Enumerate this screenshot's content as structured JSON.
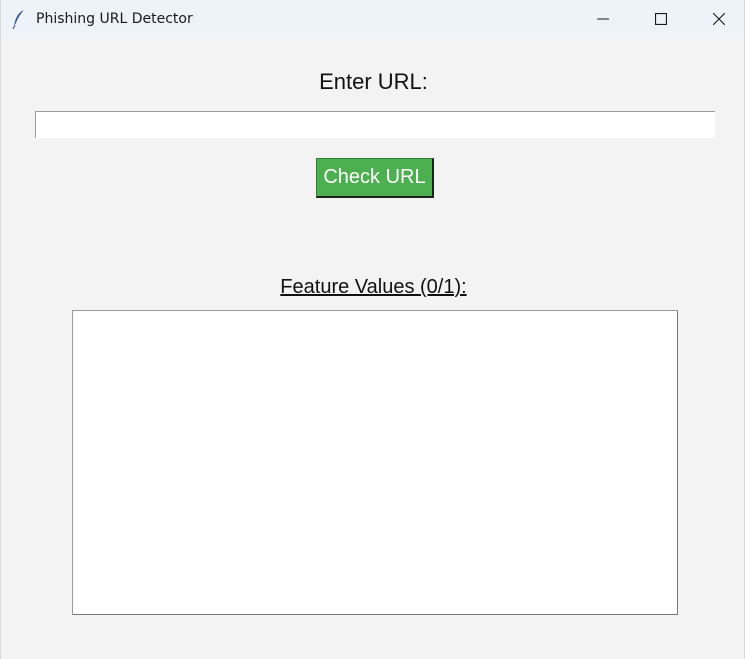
{
  "window": {
    "title": "Phishing URL Detector",
    "app_icon": "feather-icon",
    "controls": {
      "minimize_icon": "minimize-icon",
      "maximize_icon": "maximize-icon",
      "close_icon": "close-icon"
    }
  },
  "form": {
    "url_label": "Enter URL:",
    "url_value": "",
    "check_button_label": "Check URL"
  },
  "results": {
    "feature_label": "Feature Values (0/1):",
    "feature_text": ""
  },
  "colors": {
    "button_bg": "#4caf50",
    "button_text": "#ffffff",
    "window_bg": "#f3f3f3",
    "titlebar_bg": "#eef2f9"
  }
}
